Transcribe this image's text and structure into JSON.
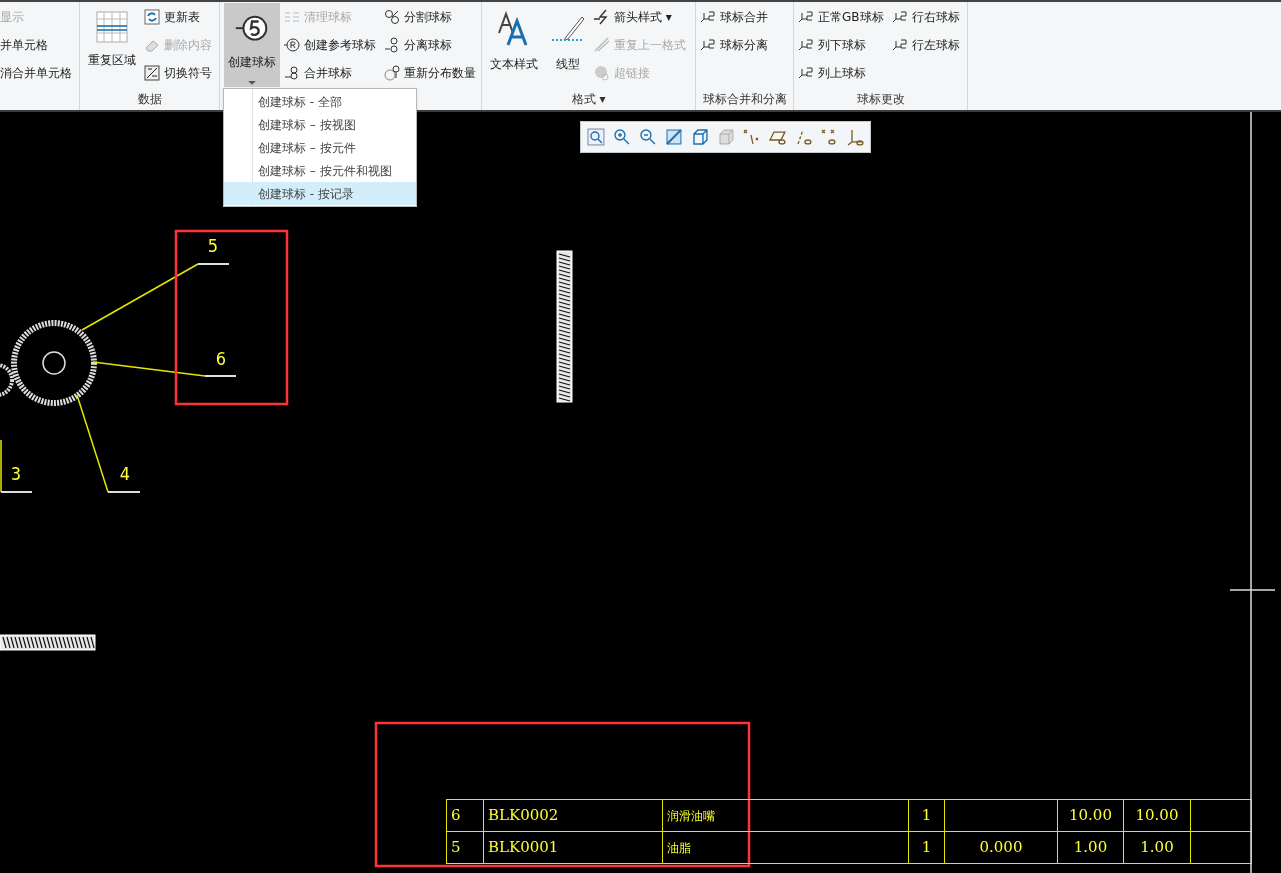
{
  "ribbon": {
    "groups": [
      {
        "columns": [
          [
            {
              "label": "显示",
              "disabled": true
            },
            {
              "label": "并单元格",
              "disabled": false
            },
            {
              "label": "消合并单元格",
              "disabled": false
            }
          ]
        ]
      },
      {
        "label": "数据",
        "large": [
          {
            "label": "重复区域",
            "pressed": false,
            "dropdown": false
          }
        ],
        "columns": [
          [
            {
              "label": "更新表",
              "disabled": false
            },
            {
              "label": "删除内容",
              "disabled": true
            },
            {
              "label": "切换符号",
              "disabled": false
            }
          ]
        ]
      },
      {
        "large": [
          {
            "label": "创建球标",
            "pressed": true,
            "dropdown": true
          }
        ],
        "columns": [
          [
            {
              "label": "清理球标",
              "disabled": true
            },
            {
              "label": "创建参考球标",
              "disabled": false
            },
            {
              "label": "合并球标",
              "disabled": false
            }
          ],
          [
            {
              "label": "分割球标",
              "disabled": false
            },
            {
              "label": "分离球标",
              "disabled": false
            },
            {
              "label": "重新分布数量",
              "disabled": false
            }
          ]
        ]
      },
      {
        "label": "格式 ▾",
        "large": [
          {
            "label": "文本样式",
            "pressed": false,
            "dropdown": false
          },
          {
            "label": "线型",
            "pressed": false,
            "dropdown": false
          }
        ],
        "columns": [
          [
            {
              "label": "箭头样式 ▾",
              "disabled": false
            },
            {
              "label": "重复上一格式",
              "disabled": true
            },
            {
              "label": "超链接",
              "disabled": true
            }
          ]
        ]
      },
      {
        "label": "球标合并和分离",
        "columns": [
          [
            {
              "label": "球标合并",
              "disabled": false
            },
            {
              "label": "球标分离",
              "disabled": false
            }
          ]
        ]
      },
      {
        "label": "球标更改",
        "columns": [
          [
            {
              "label": "正常GB球标",
              "disabled": false
            },
            {
              "label": "列下球标",
              "disabled": false
            },
            {
              "label": "列上球标",
              "disabled": false
            }
          ],
          [
            {
              "label": "行右球标",
              "disabled": false
            },
            {
              "label": "行左球标",
              "disabled": false
            }
          ]
        ]
      }
    ]
  },
  "dropdown_menu": [
    {
      "label": "创建球标 - 全部",
      "selected": false
    },
    {
      "label": "创建球标 – 按视图",
      "selected": false
    },
    {
      "label": "创建球标 – 按元件",
      "selected": false
    },
    {
      "label": "创建球标 – 按元件和视图",
      "selected": false
    },
    {
      "label": "创建球标 - 按记录",
      "selected": true
    }
  ],
  "drawing": {
    "balloons": [
      "5",
      "6",
      "3",
      "4"
    ],
    "table": {
      "rows": [
        [
          "6",
          "BLK0002",
          "润滑油嘴",
          "1",
          "",
          "10.00",
          "10.00",
          ""
        ],
        [
          "5",
          "BLK0001",
          "油脂",
          "1",
          "0.000",
          "1.00",
          "1.00",
          ""
        ]
      ]
    }
  }
}
